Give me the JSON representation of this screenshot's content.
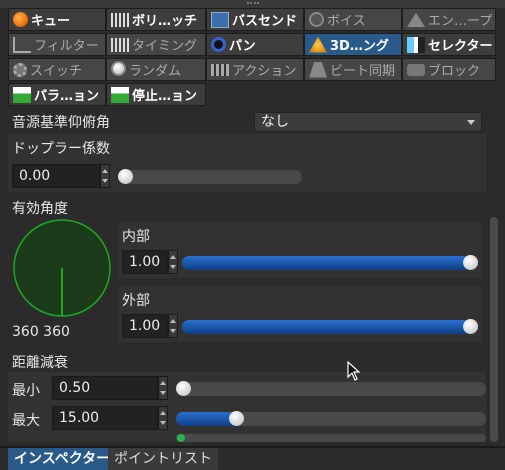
{
  "window": {
    "title": "インスペクター"
  },
  "tabs": [
    {
      "label": "キュー",
      "icon": "orange-sphere-icon",
      "state": "bright"
    },
    {
      "label": "ボリ…ッチ",
      "icon": "equalizer-icon",
      "state": "bright"
    },
    {
      "label": "バスセンド",
      "icon": "bus-send-icon",
      "state": "bright"
    },
    {
      "label": "ボイス",
      "icon": "voice-icon",
      "state": "dim"
    },
    {
      "label": "エン…ープ",
      "icon": "envelope-icon",
      "state": "dim"
    },
    {
      "label": "フィルター",
      "icon": "filter-icon",
      "state": "dim"
    },
    {
      "label": "タイミング",
      "icon": "timing-icon",
      "state": "dim"
    },
    {
      "label": "パン",
      "icon": "pan-icon",
      "state": "bright"
    },
    {
      "label": "3D…ング",
      "icon": "3d-positioning-icon",
      "state": "selected"
    },
    {
      "label": "セレクター",
      "icon": "selector-icon",
      "state": "bright"
    },
    {
      "label": "スイッチ",
      "icon": "switch-icon",
      "state": "dim"
    },
    {
      "label": "ランダム",
      "icon": "random-icon",
      "state": "dim"
    },
    {
      "label": "アクション",
      "icon": "action-icon",
      "state": "dim"
    },
    {
      "label": "ビート同期",
      "icon": "beat-sync-icon",
      "state": "dim"
    },
    {
      "label": "ブロック",
      "icon": "block-icon",
      "state": "dim"
    },
    {
      "label": "パラ…ョン",
      "icon": "parameter-icon",
      "state": "bright"
    },
    {
      "label": "停止…ョン",
      "icon": "stop-icon",
      "state": "bright"
    }
  ],
  "properties": {
    "source_elevation": {
      "label": "音源基準仰俯角",
      "value": "なし"
    },
    "doppler": {
      "label": "ドップラー係数",
      "value": "0.00",
      "slider_fraction": 0.0
    },
    "angle": {
      "label": "有効角度",
      "circle_caption": "360 360",
      "inner": {
        "label": "内部",
        "value": "1.00",
        "slider_fraction": 1.0
      },
      "outer": {
        "label": "外部",
        "value": "1.00",
        "slider_fraction": 1.0
      }
    },
    "distance": {
      "label": "距離減衰",
      "min": {
        "label": "最小",
        "value": "0.50",
        "slider_fraction": 0.0
      },
      "max": {
        "label": "最大",
        "value": "15.00",
        "slider_fraction": 0.18
      }
    }
  },
  "bottom_tabs": [
    {
      "label": "インスペクター",
      "active": true
    },
    {
      "label": "ポイントリスト",
      "active": false
    }
  ],
  "colors": {
    "accent": "#2a5a8a",
    "slider_fill": "#1a5cb8",
    "circle_green": "#1ea81e"
  }
}
